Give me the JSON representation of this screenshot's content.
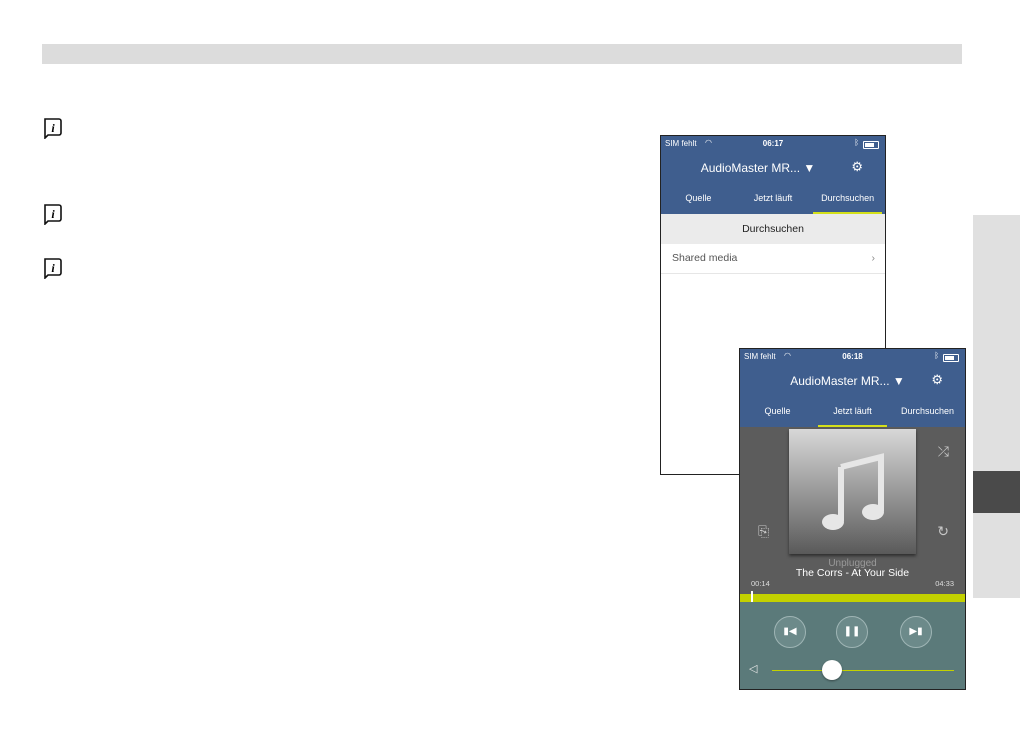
{
  "browse_screen": {
    "status": {
      "carrier": "SIM fehlt",
      "time": "06:17"
    },
    "device_name": "AudioMaster MR...",
    "tabs": [
      "Quelle",
      "Jetzt läuft",
      "Durchsuchen"
    ],
    "active_tab": "Durchsuchen",
    "section_title": "Durchsuchen",
    "items": [
      {
        "label": "Shared media"
      }
    ]
  },
  "now_playing_screen": {
    "status": {
      "carrier": "SIM fehlt",
      "time": "06:18"
    },
    "device_name": "AudioMaster MR...",
    "tabs": [
      "Quelle",
      "Jetzt läuft",
      "Durchsuchen"
    ],
    "active_tab": "Jetzt läuft",
    "album": "Unplugged",
    "track": "The Corrs - At Your Side",
    "elapsed": "00:14",
    "total": "04:33",
    "progress_fraction": 0.05,
    "volume_fraction": 0.33
  },
  "colors": {
    "nav": "#3f5e8e",
    "accent": "#c3d100",
    "player_bg": "#5c5c5c",
    "controls_bg": "#5b7a7a"
  },
  "icons": [
    "info-icon",
    "wifi-icon",
    "bluetooth-icon",
    "battery-icon",
    "gear-icon",
    "dropdown-arrow-icon",
    "chevron-right-icon",
    "music-note-icon",
    "shuffle-icon",
    "share-icon",
    "repeat-icon",
    "previous-icon",
    "pause-icon",
    "next-icon",
    "speaker-icon"
  ]
}
